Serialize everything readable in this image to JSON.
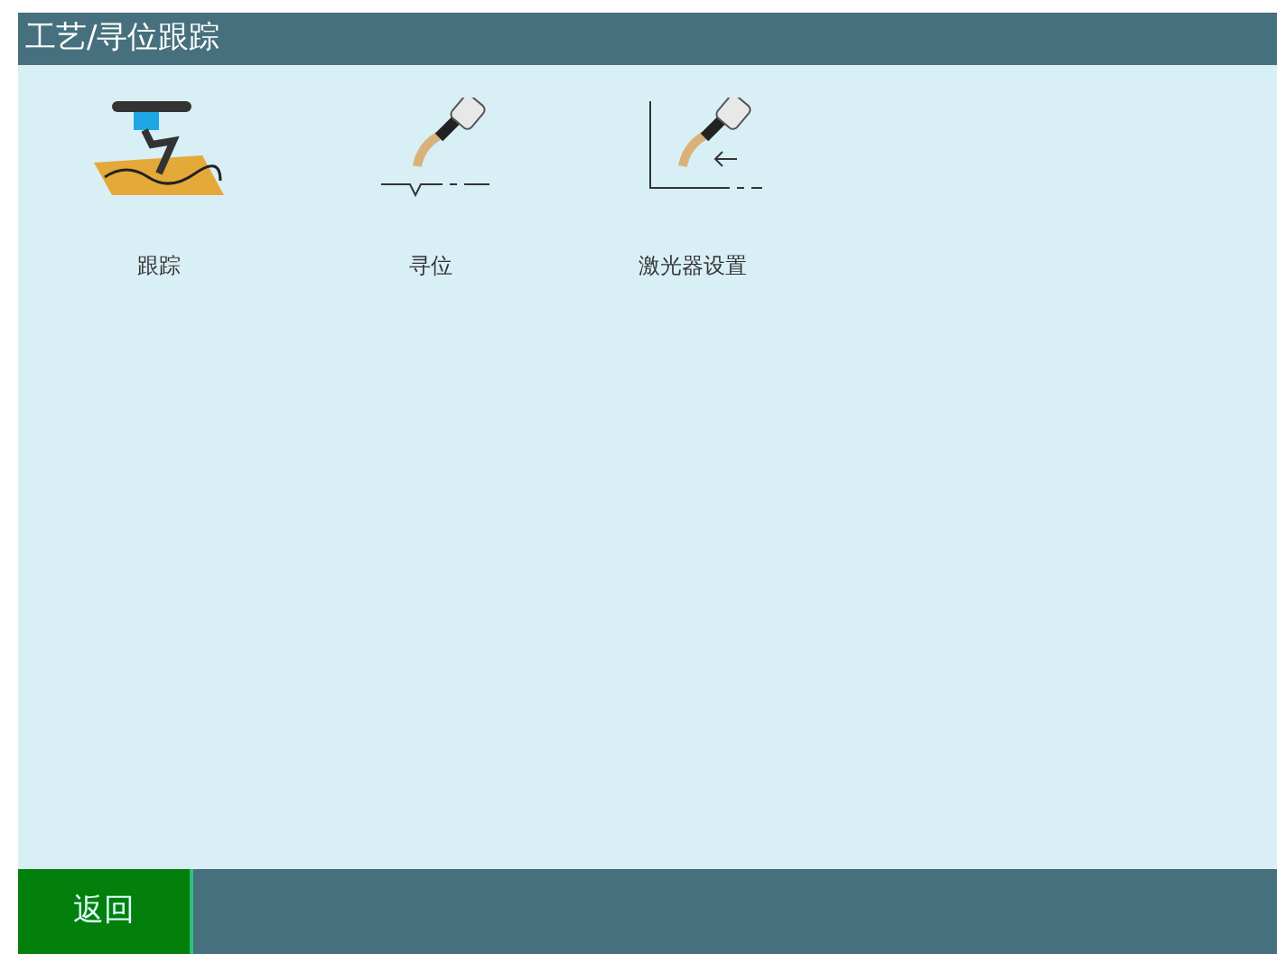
{
  "window": {
    "title": "工艺/寻位跟踪"
  },
  "items": [
    {
      "kind": "tracking",
      "label": "跟踪"
    },
    {
      "kind": "seeking",
      "label": "寻位"
    },
    {
      "kind": "laser",
      "label": "激光器设置"
    }
  ],
  "buttons": [
    {
      "label": "返回"
    }
  ]
}
